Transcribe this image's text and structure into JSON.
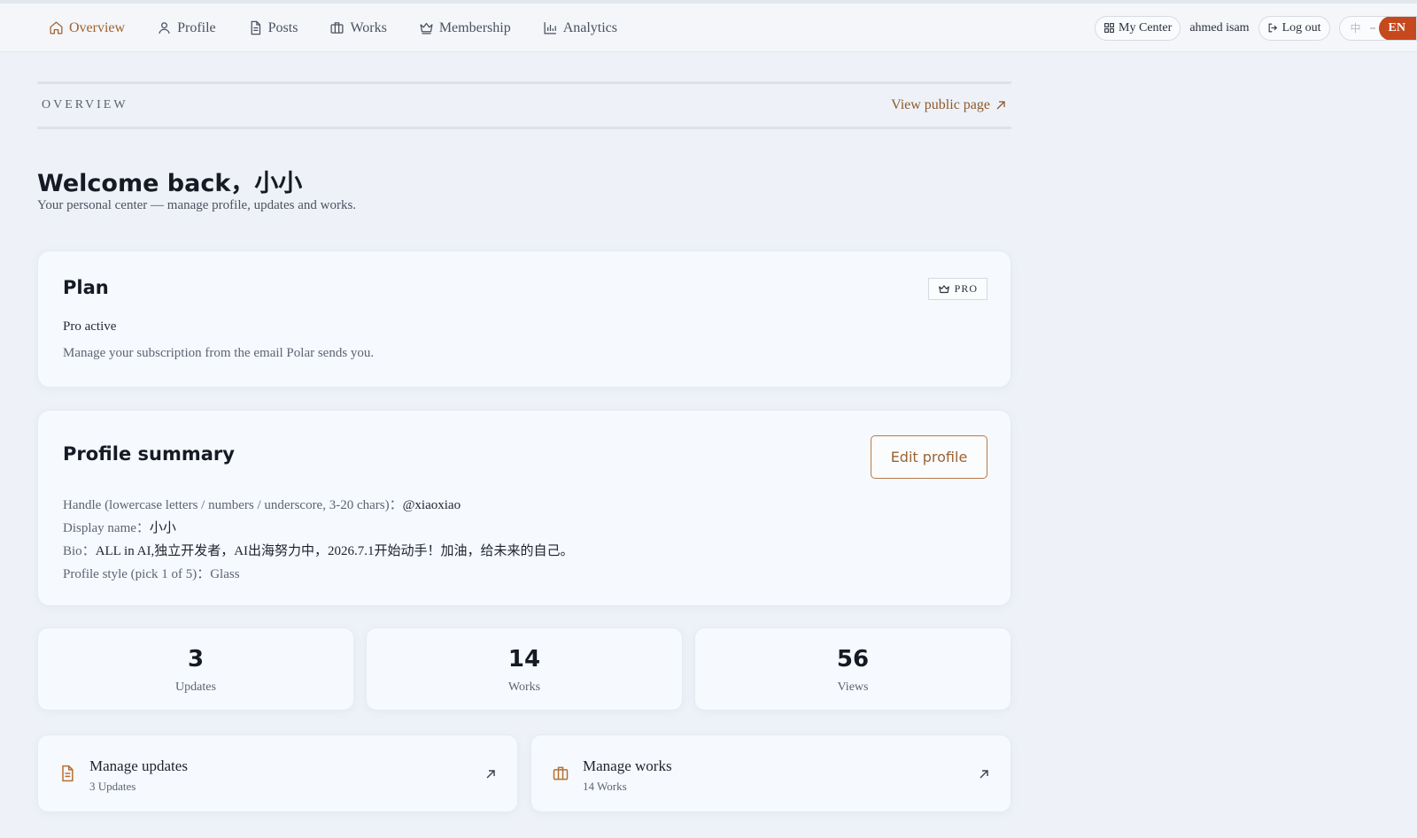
{
  "nav": {
    "items": [
      {
        "label": "Overview",
        "icon": "home-icon"
      },
      {
        "label": "Profile",
        "icon": "user-icon"
      },
      {
        "label": "Posts",
        "icon": "document-icon"
      },
      {
        "label": "Works",
        "icon": "briefcase-icon"
      },
      {
        "label": "Membership",
        "icon": "crown-icon"
      },
      {
        "label": "Analytics",
        "icon": "bar-chart-icon"
      }
    ],
    "active": "Overview",
    "my_center": "My Center",
    "user_name": "ahmed isam",
    "logout": "Log out",
    "lang_zh": "中",
    "lang_en": "EN",
    "accent_color": "#a0622a",
    "lang_active_color": "#c6491e"
  },
  "header": {
    "section_label": "OVERVIEW",
    "view_public": "View public page"
  },
  "welcome": {
    "title": "Welcome back，小小",
    "subtitle": "Your personal center — manage profile, updates and works."
  },
  "plan": {
    "title": "Plan",
    "badge": "PRO",
    "status": "Pro active",
    "note": "Manage your subscription from the email Polar sends you."
  },
  "profile": {
    "title": "Profile summary",
    "edit_button": "Edit profile",
    "handle_label": "Handle (lowercase letters / numbers / underscore, 3-20 chars)：",
    "handle_value": "@xiaoxiao",
    "display_label": "Display name：",
    "display_value": "小小",
    "bio_label": "Bio：",
    "bio_value": "ALL in AI,独立开发者，AI出海努力中，2026.7.1开始动手！加油，给未来的自己。",
    "style_label": "Profile style (pick 1 of 5)：",
    "style_value": "Glass"
  },
  "stats": [
    {
      "value": "3",
      "label": "Updates"
    },
    {
      "value": "14",
      "label": "Works"
    },
    {
      "value": "56",
      "label": "Views"
    }
  ],
  "links": [
    {
      "title": "Manage updates",
      "sub": "3 Updates",
      "icon": "document-icon"
    },
    {
      "title": "Manage works",
      "sub": "14 Works",
      "icon": "briefcase-icon"
    }
  ]
}
